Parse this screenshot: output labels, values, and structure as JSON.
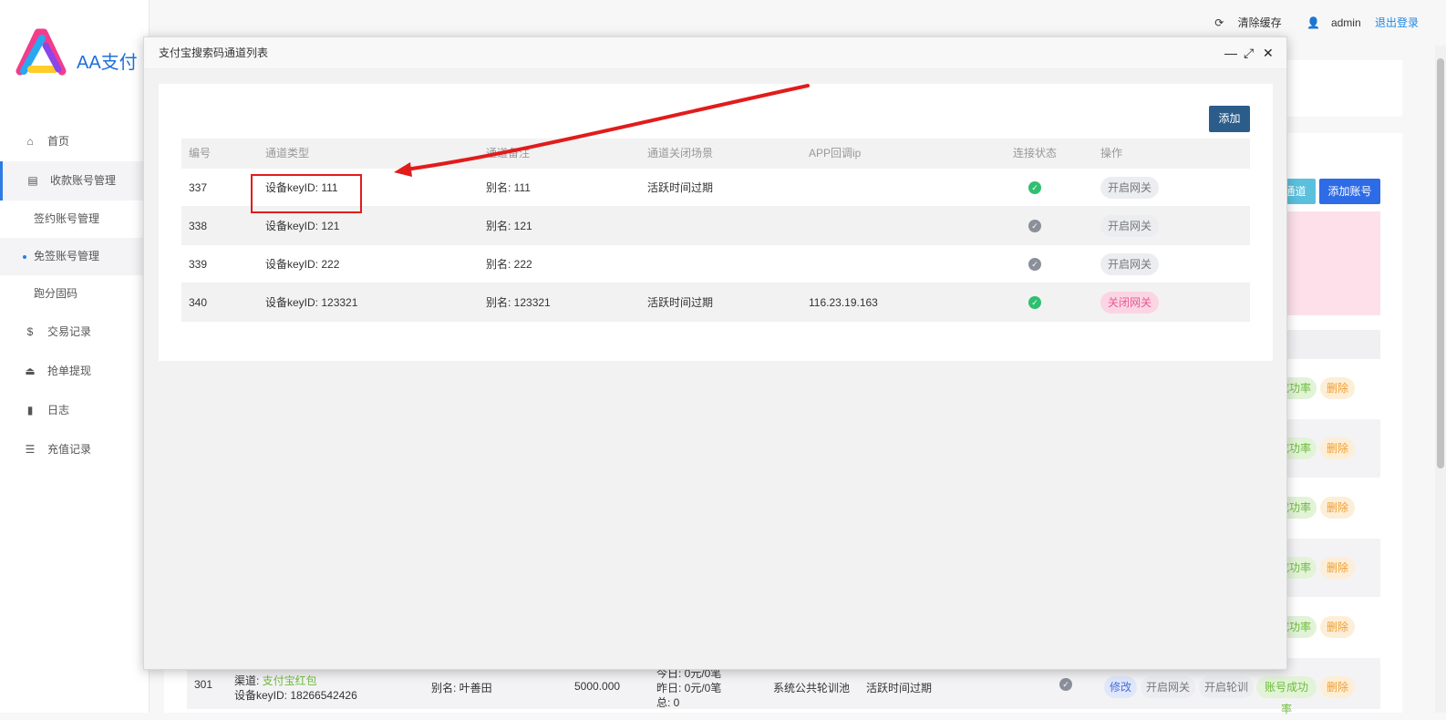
{
  "brand": {
    "name": "AA支付"
  },
  "topbar": {
    "clear_cache": "清除缓存",
    "user": "admin",
    "logout": "退出登录"
  },
  "sidebar": {
    "items": [
      {
        "icon": "home-icon",
        "label": "首页"
      },
      {
        "icon": "list-icon",
        "label": "收款账号管理"
      },
      {
        "label": "签约账号管理"
      },
      {
        "label": "免签账号管理"
      },
      {
        "label": "跑分固码"
      },
      {
        "icon": "dollar-icon",
        "label": "交易记录"
      },
      {
        "icon": "upload-icon",
        "label": "抢单提现"
      },
      {
        "icon": "book-icon",
        "label": "日志"
      },
      {
        "icon": "list-icon",
        "label": "充值记录"
      }
    ]
  },
  "background": {
    "buttons": {
      "channel": "通道",
      "add_account": "添加账号"
    },
    "row_pills": {
      "success_rate": "成功率",
      "delete": "删除"
    },
    "bottom_row": {
      "id": "301",
      "channel_label": "渠道: ",
      "channel_value": "支付宝红包",
      "device": "设备keyID: 18266542426",
      "alias": "别名: 叶善田",
      "amount": "5000.000",
      "today": "今日: 0元/0笔",
      "yesterday": "昨日: 0元/0笔",
      "total": "总: 0",
      "mode": "系统公共轮训池",
      "scene": "活跃时间过期",
      "actions": [
        "修改",
        "开启网关",
        "开启轮训",
        "账号成功率",
        "删除"
      ]
    }
  },
  "modal": {
    "title": "支付宝搜索码通道列表",
    "controls": [
      "—",
      "⤢",
      "✕"
    ],
    "add_label": "添加",
    "columns": [
      "编号",
      "通道类型",
      "通道备注",
      "通道关闭场景",
      "APP回调ip",
      "连接状态",
      "操作"
    ],
    "rows": [
      {
        "id": "337",
        "type": "设备keyID: 111",
        "remark": "别名: 111",
        "scene": "活跃时间过期",
        "ip": "",
        "connected": true,
        "action": "开启网关",
        "action_style": "open"
      },
      {
        "id": "338",
        "type": "设备keyID: 121",
        "remark": "别名: 121",
        "scene": "",
        "ip": "",
        "connected": false,
        "action": "开启网关",
        "action_style": "open"
      },
      {
        "id": "339",
        "type": "设备keyID: 222",
        "remark": "别名: 222",
        "scene": "",
        "ip": "",
        "connected": false,
        "action": "开启网关",
        "action_style": "open"
      },
      {
        "id": "340",
        "type": "设备keyID: 123321",
        "remark": "别名: 123321",
        "scene": "活跃时间过期",
        "ip": "116.23.19.163",
        "connected": true,
        "action": "关闭网关",
        "action_style": "close"
      }
    ]
  },
  "colors": {
    "accent": "#2b5c8a",
    "link": "#1e88e5",
    "annotation": "#e21b1b",
    "ok": "#2fbf71",
    "off": "#8a8f99"
  }
}
